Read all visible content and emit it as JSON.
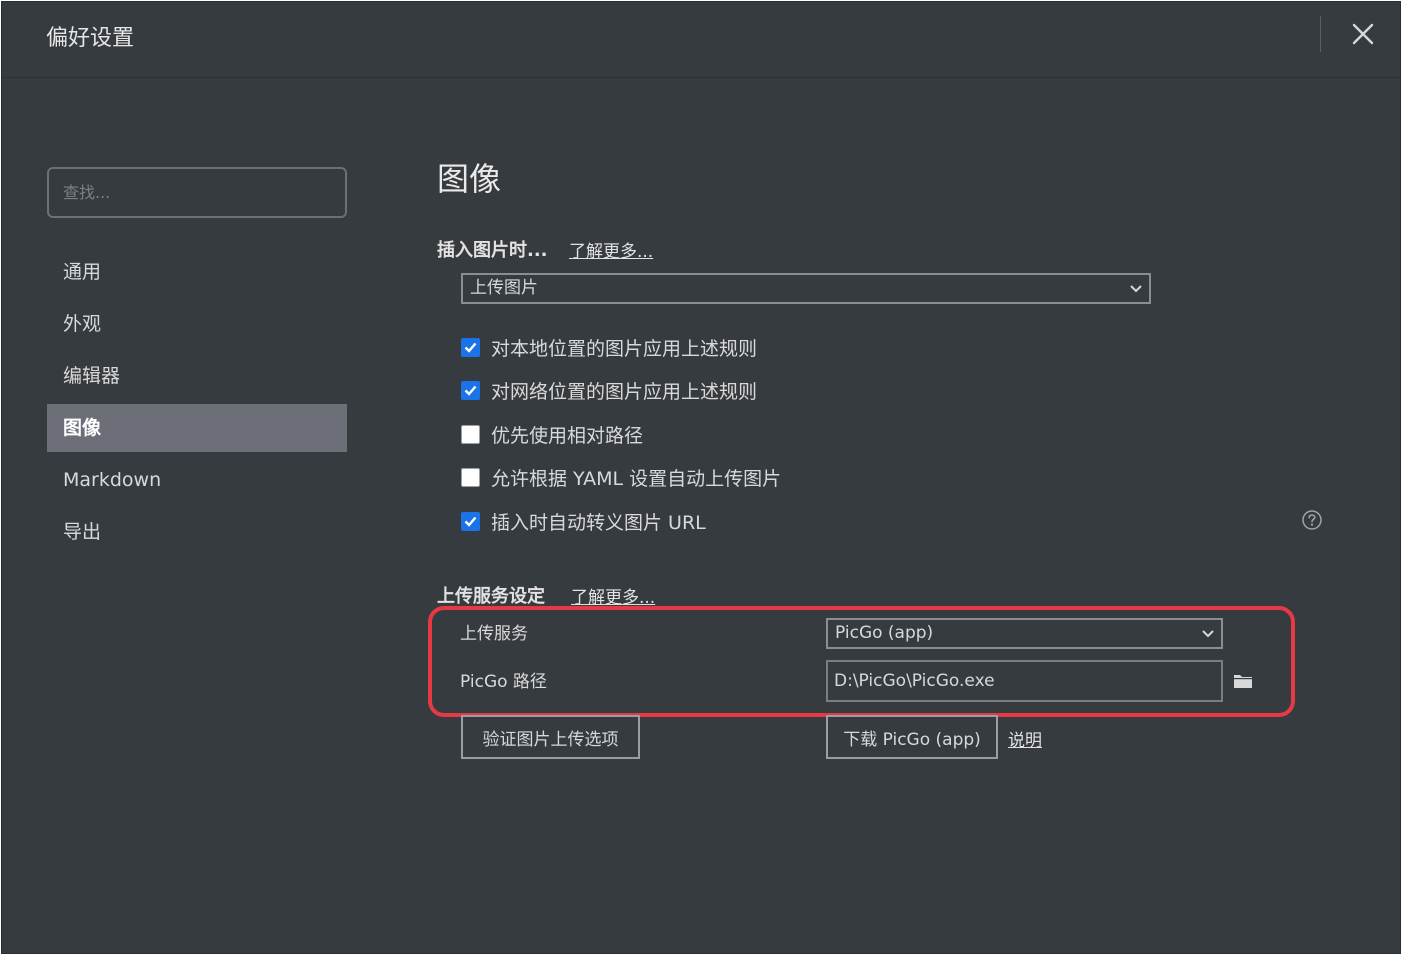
{
  "window": {
    "title": "偏好设置"
  },
  "sidebar": {
    "search_placeholder": "查找...",
    "items": [
      {
        "label": "通用"
      },
      {
        "label": "外观"
      },
      {
        "label": "编辑器"
      },
      {
        "label": "图像",
        "active": true
      },
      {
        "label": "Markdown"
      },
      {
        "label": "导出"
      }
    ]
  },
  "main": {
    "heading": "图像",
    "insert_section": {
      "title": "插入图片时...",
      "learn_more": "了解更多...",
      "select_value": "上传图片",
      "options": [
        {
          "label": "对本地位置的图片应用上述规则",
          "checked": true
        },
        {
          "label": "对网络位置的图片应用上述规则",
          "checked": true
        },
        {
          "label": "优先使用相对路径",
          "checked": false
        },
        {
          "label": "允许根据 YAML 设置自动上传图片",
          "checked": false
        },
        {
          "label": "插入时自动转义图片 URL",
          "checked": true
        }
      ]
    },
    "upload_section": {
      "title": "上传服务设定",
      "learn_more": "了解更多...",
      "service_label": "上传服务",
      "service_value": "PicGo (app)",
      "path_label": "PicGo 路径",
      "path_value": "D:\\PicGo\\PicGo.exe",
      "verify_button": "验证图片上传选项",
      "download_button": "下载 PicGo (app)",
      "help_link": "说明"
    }
  },
  "colors": {
    "background": "#363b40",
    "checkbox_checked": "#1a73e8",
    "nav_active": "#6c6e78",
    "highlight": "#e53a45"
  }
}
